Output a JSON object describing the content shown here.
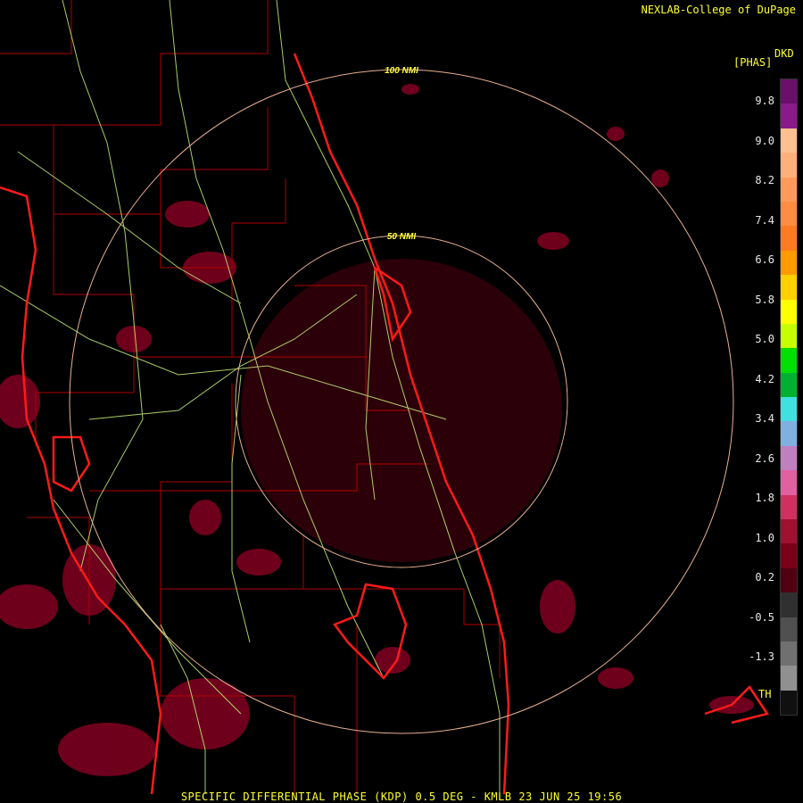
{
  "header": {
    "credit": "NEXLAB-College of DuPage"
  },
  "footer": {
    "caption": "SPECIFIC DIFFERENTIAL PHASE (KDP) 0.5 DEG - KMLB 23 JUN 25 19:56"
  },
  "range_rings": [
    {
      "label": "100 NMI",
      "range_nmi": 100
    },
    {
      "label": "50 NMI",
      "range_nmi": 50
    }
  ],
  "legend": {
    "product": "DKD",
    "unit": "[PHAS]",
    "ticks": [
      "9.8",
      "9.0",
      "8.2",
      "7.4",
      "6.6",
      "5.8",
      "5.0",
      "4.2",
      "3.4",
      "2.6",
      "1.8",
      "1.0",
      "0.2",
      "-0.5",
      "-1.3"
    ],
    "threshold_label": "TH",
    "colors": [
      "#6a0f6a",
      "#8a1a8a",
      "#ffc090",
      "#ffb07a",
      "#ff9a5a",
      "#ff8c40",
      "#ff7a20",
      "#ff9a00",
      "#ffd000",
      "#ffff00",
      "#c8ff00",
      "#00e000",
      "#00b030",
      "#40e0e0",
      "#80b0e0",
      "#c080c0",
      "#e060a0",
      "#d03060",
      "#a01030",
      "#7a0018",
      "#500010",
      "#303030",
      "#505050",
      "#707070",
      "#909090",
      "#101010"
    ]
  },
  "colors": {
    "coast": "#ff1a1a",
    "county": "#b00000",
    "highway": "#c8f07a",
    "ring": "#e8b090",
    "text": "#ffff33"
  }
}
